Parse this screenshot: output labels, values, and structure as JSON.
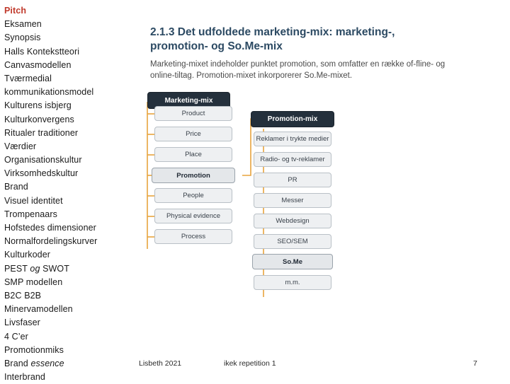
{
  "sidebar": {
    "items": [
      {
        "label": "Pitch",
        "highlight": true
      },
      {
        "label": "Eksamen"
      },
      {
        "label": "Synopsis"
      },
      {
        "label": "Halls Kontekstteori"
      },
      {
        "label": "Canvasmodellen"
      },
      {
        "label": "Tværmedial"
      },
      {
        "label": "kommunikationsmodel"
      },
      {
        "label": "Kulturens isbjerg"
      },
      {
        "label": "Kulturkonvergens"
      },
      {
        "label": "Ritualer traditioner"
      },
      {
        "label": "Værdier"
      },
      {
        "label": "Organisationskultur"
      },
      {
        "label": "Virksomhedskultur"
      },
      {
        "label": "Brand"
      },
      {
        "label": "Visuel identitet"
      },
      {
        "label": "Trompenaars"
      },
      {
        "label": "Hofstedes dimensioner"
      },
      {
        "label": "Normalfordelingskurver"
      },
      {
        "label": "Kulturkoder"
      },
      {
        "label": "PEST og SWOT",
        "italic_part": "og"
      },
      {
        "label": "SMP modellen"
      },
      {
        "label": "B2C B2B"
      },
      {
        "label": "Minervamodellen"
      },
      {
        "label": "Livsfaser"
      },
      {
        "label": "4 C’er"
      },
      {
        "label": "Promotionmiks"
      },
      {
        "label": "Brand essence",
        "italic_part": "essence"
      },
      {
        "label": "Interbrand"
      }
    ]
  },
  "slide": {
    "title": "2.1.3 Det udfoldede marketing-mix: marketing-, promotion- og So.Me-mix",
    "body": "Marketing-mixet indeholder punktet promotion, som omfatter en række of-fline- og online-tiltag. Promotion-mixet inkorporerer So.Me-mixet."
  },
  "diagram": {
    "marketing_mix_header": "Marketing-mix",
    "marketing_mix_items": [
      "Product",
      "Price",
      "Place",
      "Promotion",
      "People",
      "Physical evidence",
      "Process"
    ],
    "marketing_mix_highlight": "Promotion",
    "promotion_mix_header": "Promotion-mix",
    "promotion_mix_items": [
      "Reklamer i trykte medier",
      "Radio- og tv-reklamer",
      "PR",
      "Messer",
      "Webdesign",
      "SEO/SEM",
      "So.Me",
      "m.m."
    ],
    "promotion_mix_highlight": "So.Me",
    "colors": {
      "dark_node": "#24303c",
      "light_node": "#eef0f2",
      "connector": "#e8a33d",
      "title": "#2c4a63"
    }
  },
  "footer": {
    "left": "Lisbeth 2021",
    "center": "ikek repetition 1",
    "right": "7"
  }
}
